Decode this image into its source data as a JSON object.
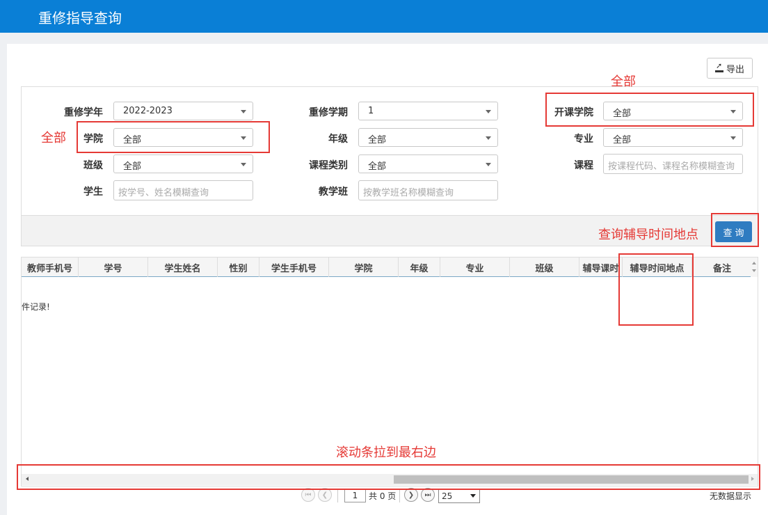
{
  "header": {
    "title": "重修指导查询"
  },
  "toolbar": {
    "export_label": "导出"
  },
  "filters": {
    "year": {
      "label": "重修学年",
      "value": "2022-2023"
    },
    "term": {
      "label": "重修学期",
      "value": "1"
    },
    "offering_college": {
      "label": "开课学院",
      "value": "全部"
    },
    "college": {
      "label": "学院",
      "value": "全部"
    },
    "grade": {
      "label": "年级",
      "value": "全部"
    },
    "major": {
      "label": "专业",
      "value": "全部"
    },
    "class": {
      "label": "班级",
      "value": "全部"
    },
    "course_type": {
      "label": "课程类别",
      "value": "全部"
    },
    "course": {
      "label": "课程",
      "placeholder": "按课程代码、课程名称模糊查询"
    },
    "student": {
      "label": "学生",
      "placeholder": "按学号、姓名模糊查询"
    },
    "teaching_class": {
      "label": "教学班",
      "placeholder": "按教学班名称模糊查询"
    }
  },
  "query_label": "查询",
  "table": {
    "columns": [
      "教师手机号",
      "学号",
      "学生姓名",
      "性别",
      "学生手机号",
      "学院",
      "年级",
      "专业",
      "班级",
      "辅导课时",
      "辅导时间地点",
      "备注"
    ],
    "empty_message": "件记录!"
  },
  "pager": {
    "page": "1",
    "total_pages_text": "共 0 页",
    "page_size": "25",
    "status": "无数据显示"
  },
  "annotations": {
    "offering_college_note": "全部",
    "college_note": "全部",
    "query_note": "查询辅导时间地点",
    "scroll_note": "滚动条拉到最右边",
    "accent_color": "#e53935"
  }
}
